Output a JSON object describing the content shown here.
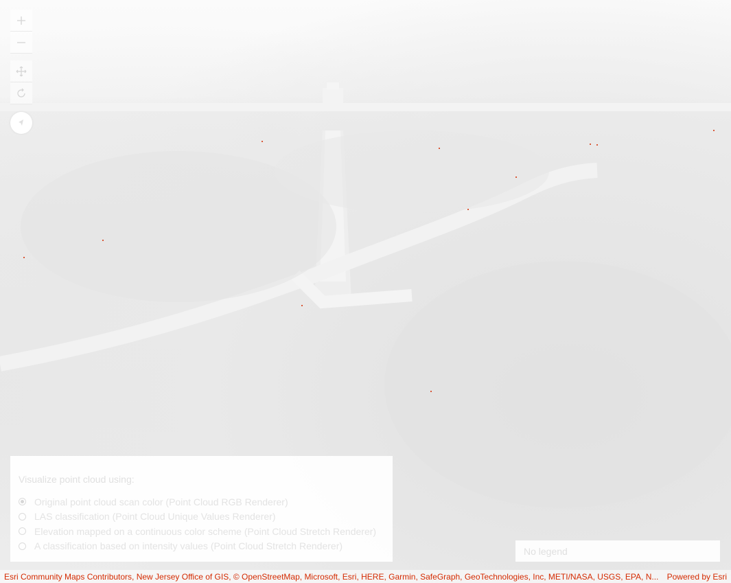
{
  "navigation": {
    "zoom_in_icon": "plus-icon",
    "zoom_out_icon": "minus-icon",
    "pan_icon": "move-icon",
    "rotate_icon": "rotate-icon",
    "compass_icon": "compass-icon"
  },
  "panel": {
    "title": "Visualize point cloud using:",
    "selected_index": 0,
    "options": [
      "Original point cloud scan color (Point Cloud RGB Renderer)",
      "LAS classification (Point Cloud Unique Values Renderer)",
      "Elevation mapped on a continuous color scheme (Point Cloud Stretch Renderer)",
      "A classification based on intensity values (Point Cloud Stretch Renderer)"
    ]
  },
  "legend": {
    "text": "No legend"
  },
  "attribution": {
    "text": "Esri Community Maps Contributors, New Jersey Office of GIS, © OpenStreetMap, Microsoft, Esri, HERE, Garmin, SafeGraph, GeoTechnologies, Inc, METI/NASA, USGS, EPA, N...",
    "powered_by": "Powered by Esri"
  },
  "colors": {
    "attribution_text": "#d42a00",
    "scene_light": "#f7f7f7",
    "scene_ground": "#e6e6e6"
  }
}
